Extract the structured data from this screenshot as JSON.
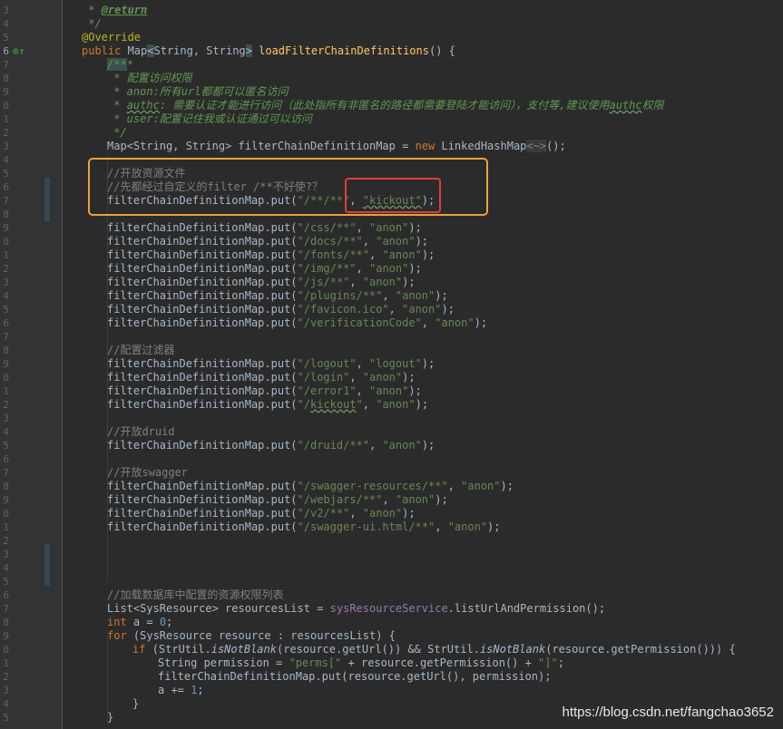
{
  "editor": {
    "gutter_line_numbers": [
      "3",
      "4",
      "5",
      "6",
      "7",
      "8",
      "9",
      "0",
      "1",
      "2",
      "3",
      "4",
      "5",
      "6",
      "7",
      "8",
      "9",
      "0",
      "1",
      "2",
      "3",
      "4",
      "5",
      "6",
      "7",
      "8",
      "9",
      "0",
      "1",
      "2",
      "3",
      "4",
      "5",
      "6",
      "7",
      "8",
      "9",
      "0",
      "1",
      "2",
      "3",
      "4",
      "5",
      "6",
      "7",
      "8",
      "9",
      "0",
      "1",
      "2",
      "3",
      "4",
      "5"
    ],
    "override_marker": "⊙↑",
    "colors": {
      "background": "#2b2b2b",
      "keyword": "#cc7832",
      "string": "#6a8759",
      "comment": "#808080",
      "javadoc": "#629755",
      "annotation": "#bbb529",
      "method": "#ffc66d",
      "number": "#6897bb",
      "highlight_box": "#e8a33d",
      "error_box": "#e23b3b"
    }
  },
  "code_lines": [
    {
      "indent": 4,
      "parts": [
        [
          "doc",
          " * "
        ],
        [
          "doctag",
          "@return"
        ]
      ]
    },
    {
      "indent": 4,
      "parts": [
        [
          "doc",
          " */"
        ]
      ]
    },
    {
      "indent": 4,
      "parts": [
        [
          "ann",
          "@Override"
        ]
      ]
    },
    {
      "indent": 4,
      "parts": [
        [
          "kw",
          "public "
        ],
        [
          "",
          "Map"
        ],
        [
          "hl",
          "<"
        ],
        [
          "",
          "String, String"
        ],
        [
          "hl",
          ">"
        ],
        [
          "",
          " "
        ],
        [
          "fn",
          "loadFilterChainDefinitions"
        ],
        [
          "",
          "() {"
        ]
      ]
    },
    {
      "indent": 8,
      "parts": [
        [
          "doc hl",
          "/**"
        ],
        [
          "doc",
          "*"
        ]
      ]
    },
    {
      "indent": 8,
      "parts": [
        [
          "doc",
          " * 配置访问权限"
        ]
      ]
    },
    {
      "indent": 8,
      "parts": [
        [
          "doc",
          " * anon:所有url都都可以匿名访问"
        ]
      ]
    },
    {
      "indent": 8,
      "parts": [
        [
          "doc",
          " * "
        ],
        [
          "doc typo",
          "authc"
        ],
        [
          "doc",
          ": 需要认证才能进行访问（此处指所有非匿名的路径都需要登陆才能访问），支付等,建议使用"
        ],
        [
          "doc typo",
          "authc"
        ],
        [
          "doc",
          "权限"
        ]
      ]
    },
    {
      "indent": 8,
      "parts": [
        [
          "doc",
          " * user:配置记住我或认证通过可以访问"
        ]
      ]
    },
    {
      "indent": 8,
      "parts": [
        [
          "doc",
          " */"
        ]
      ]
    },
    {
      "indent": 8,
      "parts": [
        [
          "",
          "Map<String, String> filterChainDefinitionMap = "
        ],
        [
          "kw",
          "new "
        ],
        [
          "",
          "LinkedHashMap"
        ],
        [
          "gen",
          "<~>"
        ],
        [
          "",
          "();"
        ]
      ]
    },
    {
      "indent": 8,
      "parts": []
    },
    {
      "indent": 8,
      "parts": [
        [
          "cmt",
          "//开放资源文件"
        ]
      ]
    },
    {
      "indent": 8,
      "parts": [
        [
          "cmt",
          "//先都经过自定义的filter /**不好使?？"
        ]
      ]
    },
    {
      "indent": 8,
      "parts": [
        [
          "",
          "filterChainDefinitionMap.put("
        ],
        [
          "str",
          "\"/**/**\""
        ],
        [
          "",
          ", "
        ],
        [
          "str typo",
          "\"kickout\""
        ],
        [
          "",
          ");"
        ]
      ]
    },
    {
      "indent": 8,
      "parts": []
    },
    {
      "indent": 8,
      "parts": [
        [
          "",
          "filterChainDefinitionMap.put("
        ],
        [
          "str",
          "\"/css/**\""
        ],
        [
          "",
          ", "
        ],
        [
          "str",
          "\"anon\""
        ],
        [
          "",
          ");"
        ]
      ]
    },
    {
      "indent": 8,
      "parts": [
        [
          "",
          "filterChainDefinitionMap.put("
        ],
        [
          "str",
          "\"/docs/**\""
        ],
        [
          "",
          ", "
        ],
        [
          "str",
          "\"anon\""
        ],
        [
          "",
          ");"
        ]
      ]
    },
    {
      "indent": 8,
      "parts": [
        [
          "",
          "filterChainDefinitionMap.put("
        ],
        [
          "str",
          "\"/fonts/**\""
        ],
        [
          "",
          ", "
        ],
        [
          "str",
          "\"anon\""
        ],
        [
          "",
          ");"
        ]
      ]
    },
    {
      "indent": 8,
      "parts": [
        [
          "",
          "filterChainDefinitionMap.put("
        ],
        [
          "str",
          "\"/img/**\""
        ],
        [
          "",
          ", "
        ],
        [
          "str",
          "\"anon\""
        ],
        [
          "",
          ");"
        ]
      ]
    },
    {
      "indent": 8,
      "parts": [
        [
          "",
          "filterChainDefinitionMap.put("
        ],
        [
          "str",
          "\"/js/**\""
        ],
        [
          "",
          ", "
        ],
        [
          "str",
          "\"anon\""
        ],
        [
          "",
          ");"
        ]
      ]
    },
    {
      "indent": 8,
      "parts": [
        [
          "",
          "filterChainDefinitionMap.put("
        ],
        [
          "str",
          "\"/plugins/**\""
        ],
        [
          "",
          ", "
        ],
        [
          "str",
          "\"anon\""
        ],
        [
          "",
          ");"
        ]
      ]
    },
    {
      "indent": 8,
      "parts": [
        [
          "",
          "filterChainDefinitionMap.put("
        ],
        [
          "str",
          "\"/favicon.ico\""
        ],
        [
          "",
          ", "
        ],
        [
          "str",
          "\"anon\""
        ],
        [
          "",
          ");"
        ]
      ]
    },
    {
      "indent": 8,
      "parts": [
        [
          "",
          "filterChainDefinitionMap.put("
        ],
        [
          "str",
          "\"/verificationCode\""
        ],
        [
          "",
          ", "
        ],
        [
          "str",
          "\"anon\""
        ],
        [
          "",
          ");"
        ]
      ]
    },
    {
      "indent": 8,
      "parts": []
    },
    {
      "indent": 8,
      "parts": [
        [
          "cmt",
          "//配置过滤器"
        ]
      ]
    },
    {
      "indent": 8,
      "parts": [
        [
          "",
          "filterChainDefinitionMap.put("
        ],
        [
          "str",
          "\"/logout\""
        ],
        [
          "",
          ", "
        ],
        [
          "str",
          "\"logout\""
        ],
        [
          "",
          ");"
        ]
      ]
    },
    {
      "indent": 8,
      "parts": [
        [
          "",
          "filterChainDefinitionMap.put("
        ],
        [
          "str",
          "\"/login\""
        ],
        [
          "",
          ", "
        ],
        [
          "str",
          "\"anon\""
        ],
        [
          "",
          ");"
        ]
      ]
    },
    {
      "indent": 8,
      "parts": [
        [
          "",
          "filterChainDefinitionMap.put("
        ],
        [
          "str",
          "\"/error1\""
        ],
        [
          "",
          ", "
        ],
        [
          "str",
          "\"anon\""
        ],
        [
          "",
          ");"
        ]
      ]
    },
    {
      "indent": 8,
      "parts": [
        [
          "",
          "filterChainDefinitionMap.put("
        ],
        [
          "str",
          "\"/"
        ],
        [
          "str typo",
          "kickout"
        ],
        [
          "str",
          "\""
        ],
        [
          "",
          ", "
        ],
        [
          "str",
          "\"anon\""
        ],
        [
          "",
          ");"
        ]
      ]
    },
    {
      "indent": 8,
      "parts": []
    },
    {
      "indent": 8,
      "parts": [
        [
          "cmt",
          "//开放druid"
        ]
      ]
    },
    {
      "indent": 8,
      "parts": [
        [
          "",
          "filterChainDefinitionMap.put("
        ],
        [
          "str",
          "\"/druid/**\""
        ],
        [
          "",
          ", "
        ],
        [
          "str",
          "\"anon\""
        ],
        [
          "",
          ");"
        ]
      ]
    },
    {
      "indent": 8,
      "parts": []
    },
    {
      "indent": 8,
      "parts": [
        [
          "cmt",
          "//开放swagger"
        ]
      ]
    },
    {
      "indent": 8,
      "parts": [
        [
          "",
          "filterChainDefinitionMap.put("
        ],
        [
          "str",
          "\"/swagger-resources/**\""
        ],
        [
          "",
          ", "
        ],
        [
          "str",
          "\"anon\""
        ],
        [
          "",
          ");"
        ]
      ]
    },
    {
      "indent": 8,
      "parts": [
        [
          "",
          "filterChainDefinitionMap.put("
        ],
        [
          "str",
          "\"/webjars/**\""
        ],
        [
          "",
          ", "
        ],
        [
          "str",
          "\"anon\""
        ],
        [
          "",
          ");"
        ]
      ]
    },
    {
      "indent": 8,
      "parts": [
        [
          "",
          "filterChainDefinitionMap.put("
        ],
        [
          "str",
          "\"/v2/**\""
        ],
        [
          "",
          ", "
        ],
        [
          "str",
          "\"anon\""
        ],
        [
          "",
          ");"
        ]
      ]
    },
    {
      "indent": 8,
      "parts": [
        [
          "",
          "filterChainDefinitionMap.put("
        ],
        [
          "str",
          "\"/swagger-ui.html/**\""
        ],
        [
          "",
          ", "
        ],
        [
          "str",
          "\"anon\""
        ],
        [
          "",
          ");"
        ]
      ]
    },
    {
      "indent": 8,
      "parts": []
    },
    {
      "indent": 8,
      "parts": []
    },
    {
      "indent": 8,
      "parts": []
    },
    {
      "indent": 8,
      "parts": []
    },
    {
      "indent": 8,
      "parts": [
        [
          "cmt",
          "//加载数据库中配置的资源权限列表"
        ]
      ]
    },
    {
      "indent": 8,
      "parts": [
        [
          "",
          "List<SysResource> resourcesList = "
        ],
        [
          "fld",
          "sysResourceService"
        ],
        [
          "",
          ".listUrlAndPermission();"
        ]
      ]
    },
    {
      "indent": 8,
      "parts": [
        [
          "kw",
          "int "
        ],
        [
          "",
          "a = "
        ],
        [
          "num",
          "0"
        ],
        [
          "",
          ";"
        ]
      ]
    },
    {
      "indent": 8,
      "parts": [
        [
          "kw",
          "for "
        ],
        [
          "",
          "(SysResource resource : resourcesList) {"
        ]
      ]
    },
    {
      "indent": 12,
      "parts": [
        [
          "kw",
          "if "
        ],
        [
          "",
          "(StrUtil."
        ],
        [
          "stat",
          "isNotBlank"
        ],
        [
          "",
          "(resource.getUrl()) && StrUtil."
        ],
        [
          "stat",
          "isNotBlank"
        ],
        [
          "",
          "(resource.getPermission())) {"
        ]
      ]
    },
    {
      "indent": 16,
      "parts": [
        [
          "",
          "String permission = "
        ],
        [
          "str",
          "\"perms[\""
        ],
        [
          "",
          " + resource.getPermission() + "
        ],
        [
          "str",
          "\"]\""
        ],
        [
          "",
          ";"
        ]
      ]
    },
    {
      "indent": 16,
      "parts": [
        [
          "",
          "filterChainDefinitionMap.put(resource.getUrl(), permission);"
        ]
      ]
    },
    {
      "indent": 16,
      "parts": [
        [
          "",
          "a += "
        ],
        [
          "num",
          "1"
        ],
        [
          "",
          ";"
        ]
      ]
    },
    {
      "indent": 12,
      "parts": [
        [
          "",
          "}"
        ]
      ]
    },
    {
      "indent": 8,
      "parts": [
        [
          "",
          "}"
        ]
      ]
    }
  ],
  "watermark": "https://blog.csdn.net/fangchao3652"
}
